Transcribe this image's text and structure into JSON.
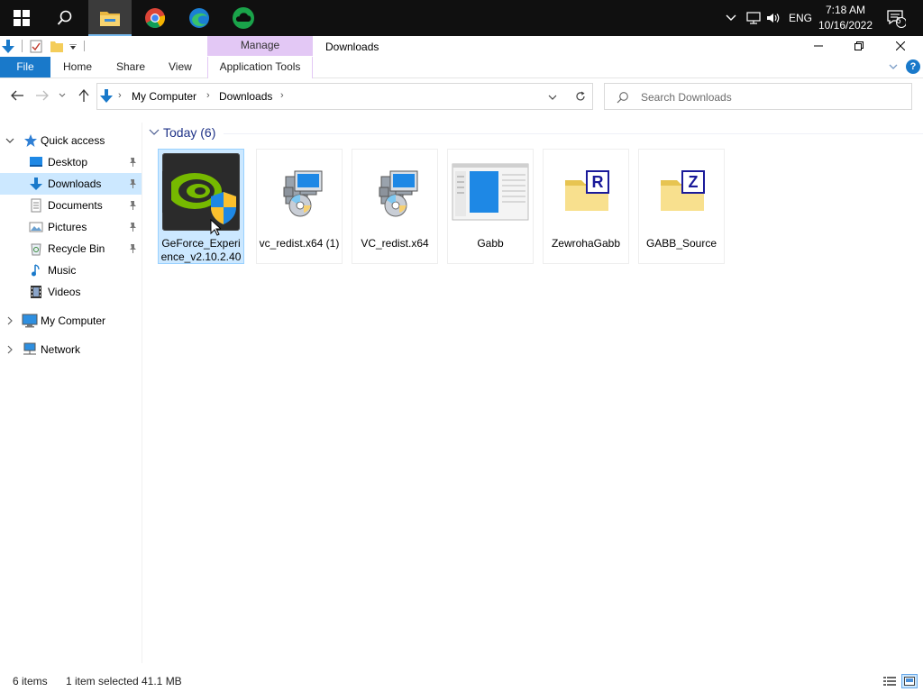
{
  "taskbar": {
    "apps": [
      {
        "name": "start",
        "icon": "windows-logo-icon"
      },
      {
        "name": "search",
        "icon": "search-icon"
      },
      {
        "name": "file-explorer",
        "icon": "folder-icon",
        "active": true
      },
      {
        "name": "chrome",
        "icon": "chrome-icon"
      },
      {
        "name": "edge",
        "icon": "edge-icon"
      },
      {
        "name": "cloud-app",
        "icon": "green-cloud-icon"
      }
    ],
    "language": "ENG",
    "time": "7:18 AM",
    "date": "10/16/2022",
    "notification_count": "6"
  },
  "window": {
    "title": "Downloads",
    "context_tab": "Manage"
  },
  "ribbon": {
    "file": "File",
    "home": "Home",
    "share": "Share",
    "view": "View",
    "app_tools": "Application Tools",
    "help": "?"
  },
  "address": {
    "segments": [
      "My Computer",
      "Downloads"
    ],
    "search_placeholder": "Search Downloads"
  },
  "nav": {
    "quick_access": "Quick access",
    "items": [
      {
        "label": "Desktop",
        "pinned": true
      },
      {
        "label": "Downloads",
        "pinned": true,
        "selected": true
      },
      {
        "label": "Documents",
        "pinned": true
      },
      {
        "label": "Pictures",
        "pinned": true
      },
      {
        "label": "Recycle Bin",
        "pinned": true
      },
      {
        "label": "Music",
        "pinned": false
      },
      {
        "label": "Videos",
        "pinned": false
      }
    ],
    "my_computer": "My Computer",
    "network": "Network"
  },
  "content": {
    "group_title": "Today (6)",
    "files": [
      {
        "name": "GeForce_Experience_v2.10.2.40",
        "icon": "nvidia-installer-icon",
        "selected": true
      },
      {
        "name": "vc_redist.x64 (1)",
        "icon": "installer-package-icon"
      },
      {
        "name": "VC_redist.x64",
        "icon": "installer-package-icon"
      },
      {
        "name": "Gabb",
        "icon": "app-window-icon"
      },
      {
        "name": "ZewrohaGabb",
        "icon": "zip-folder-r-icon"
      },
      {
        "name": "GABB_Source",
        "icon": "zip-folder-z-icon"
      }
    ]
  },
  "status": {
    "items": "6 items",
    "selected": "1 item selected",
    "size": "41.1 MB"
  },
  "colors": {
    "accent": "#1979ca",
    "selection": "#cce8ff",
    "context_tab": "#e3c8f5",
    "taskbar": "#101010"
  }
}
